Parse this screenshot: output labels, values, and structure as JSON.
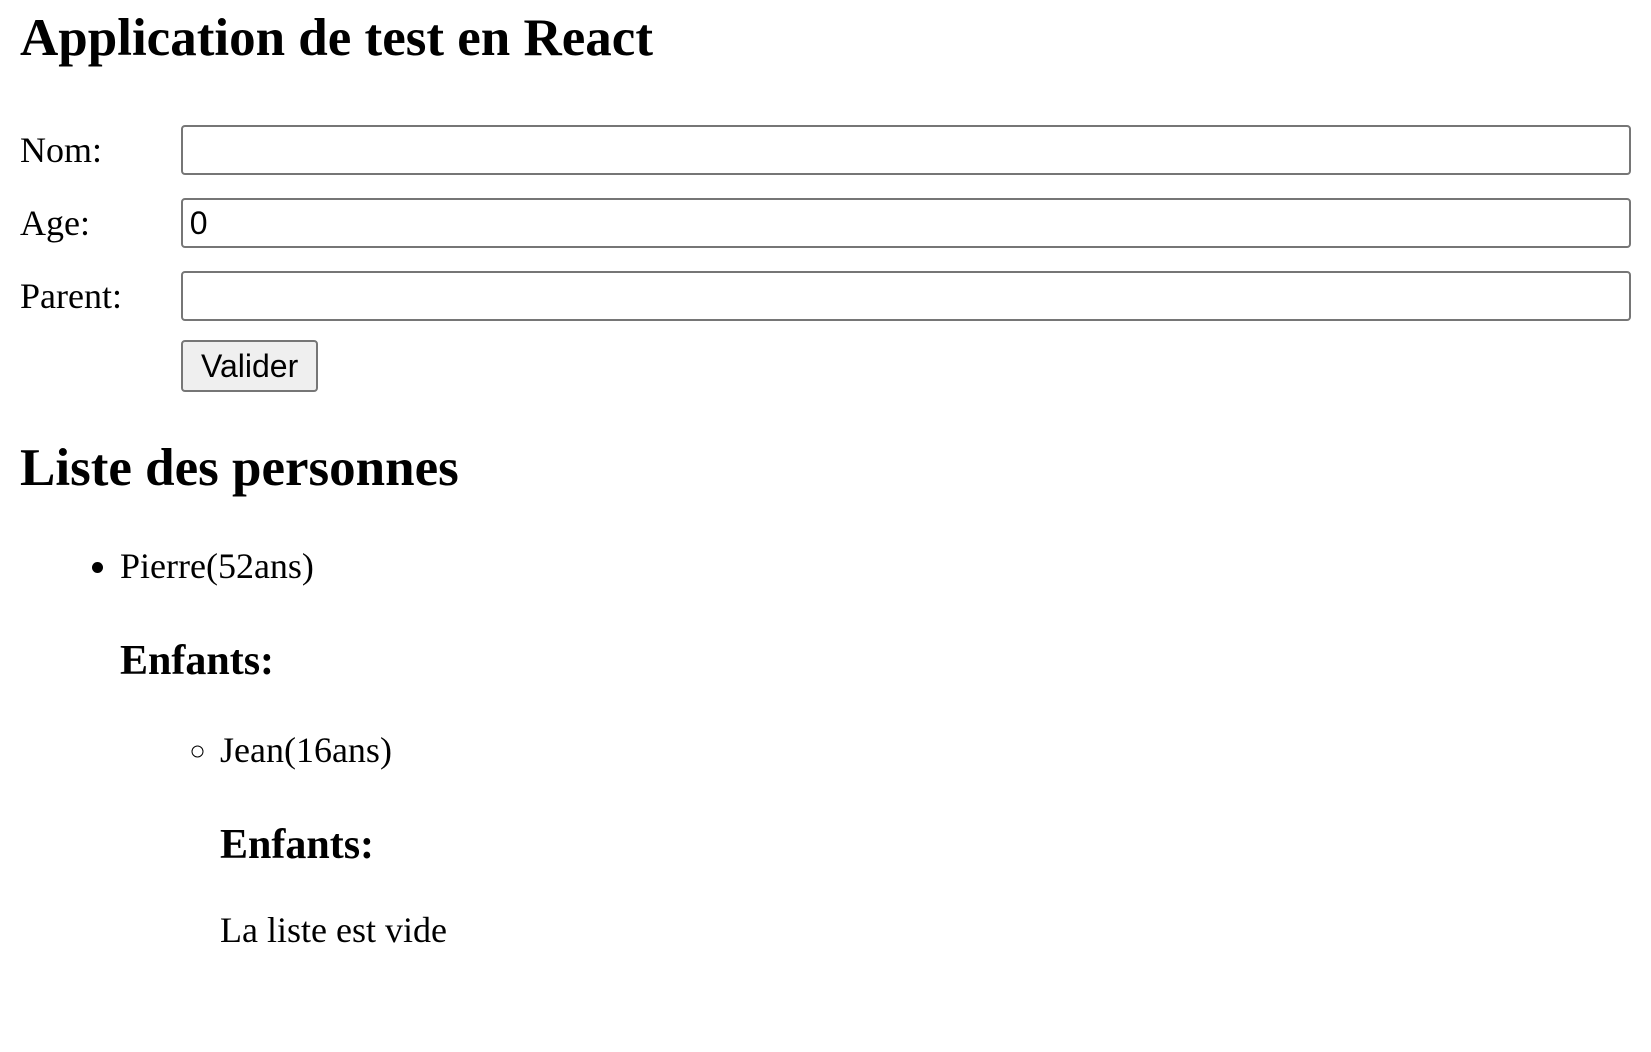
{
  "header": {
    "title": "Application de test en React"
  },
  "form": {
    "nom_label": "Nom:",
    "nom_value": "",
    "age_label": "Age:",
    "age_value": "0",
    "parent_label": "Parent:",
    "parent_value": "",
    "submit_label": "Valider"
  },
  "list": {
    "title": "Liste des personnes",
    "persons": [
      {
        "label": "Pierre(52ans)",
        "children_heading": "Enfants:",
        "children": [
          {
            "label": "Jean(16ans)",
            "children_heading": "Enfants:",
            "empty_text": "La liste est vide"
          }
        ]
      }
    ]
  }
}
